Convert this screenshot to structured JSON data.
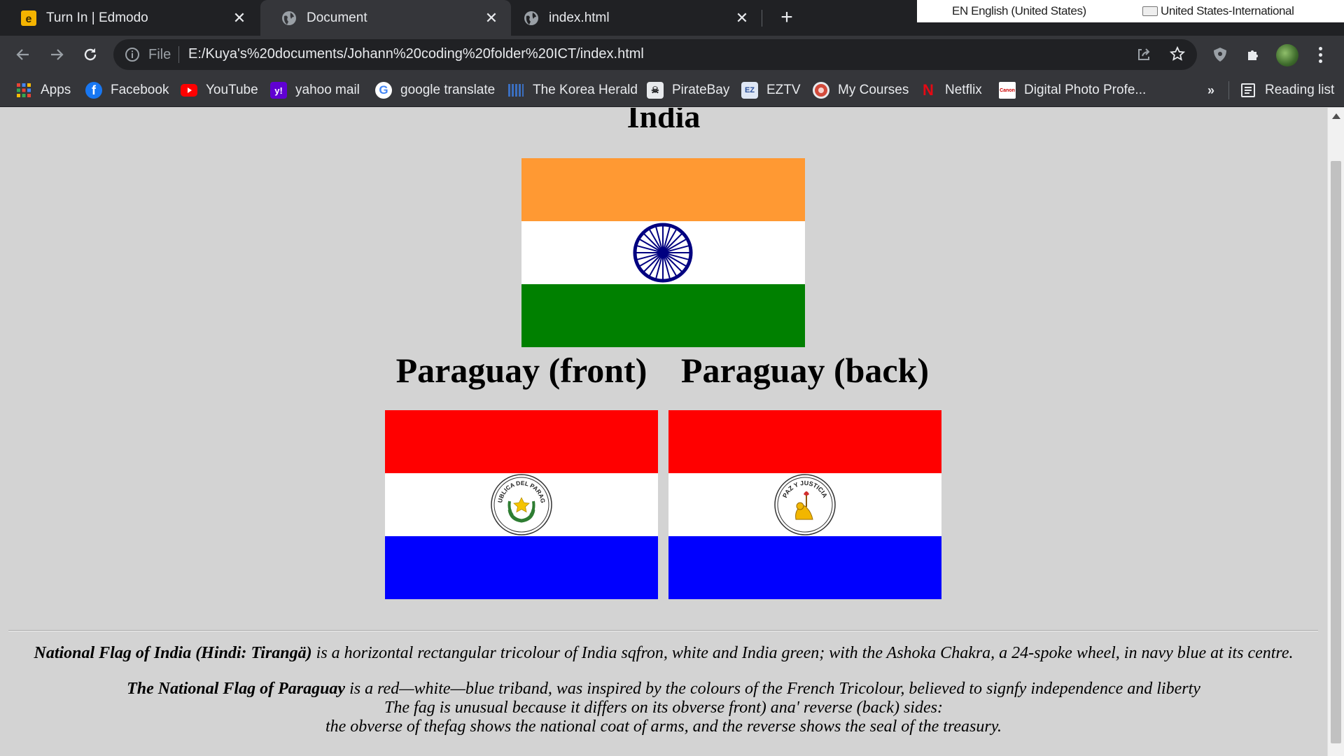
{
  "browser": {
    "tabs": [
      {
        "label": "Turn In | Edmodo",
        "favicon": "edmodo-icon"
      },
      {
        "label": "Document",
        "favicon": "globe-icon"
      },
      {
        "label": "index.html",
        "favicon": "globe-icon"
      }
    ],
    "new_tab": "+",
    "ime": {
      "language": "EN English (United States)",
      "keyboard": "United States-International"
    },
    "omnibox": {
      "scheme_label": "File",
      "url": "E:/Kuya's%20documents/Johann%20coding%20folder%20ICT/index.html"
    },
    "bookmarks": [
      {
        "label": "Apps",
        "icon": "apps-grid-icon"
      },
      {
        "label": "Facebook",
        "icon": "facebook-icon"
      },
      {
        "label": "YouTube",
        "icon": "youtube-icon"
      },
      {
        "label": "yahoo mail",
        "icon": "yahoo-icon"
      },
      {
        "label": "google translate",
        "icon": "google-icon"
      },
      {
        "label": "The Korea Herald",
        "icon": "korea-herald-icon"
      },
      {
        "label": "PirateBay",
        "icon": "piratebay-icon"
      },
      {
        "label": "EZTV",
        "icon": "eztv-icon"
      },
      {
        "label": "My Courses",
        "icon": "my-courses-icon"
      },
      {
        "label": "Netflix",
        "icon": "netflix-icon"
      },
      {
        "label": "Digital Photo Profe...",
        "icon": "canon-icon"
      }
    ],
    "bookmarks_overflow": "»",
    "reading_list": "Reading list"
  },
  "page": {
    "heading_india": "India",
    "heading_paraguay_front": "Paraguay (front)",
    "heading_paraguay_back": "Paraguay (back)",
    "india_flag_colors": {
      "saffron": "#ff9933",
      "white": "#ffffff",
      "green": "#008000",
      "chakra": "#000080"
    },
    "paraguay_flag_colors": {
      "red": "#ff0000",
      "white": "#ffffff",
      "blue": "#0000ff"
    },
    "paraguay_front_seal_text": "REPUBLICA DEL PARAGUAY",
    "paraguay_back_seal_text": "PAZ Y JUSTICIA",
    "india_desc_bold": "National Flag of India (Hindi: Tirangä)",
    "india_desc_rest": " is a horizontal rectangular tricolour of India sqfron, white and India green; with the Ashoka Chakra, a 24-spoke wheel, in navy blue at its centre.",
    "paraguay_desc_bold": "The National Flag of Paraguay",
    "paraguay_desc_rest": " is a red—white—blue triband, was inspired by the colours of the French Tricolour, believed to signfy independence and liberty",
    "paraguay_desc_line2": "The fag is unusual because it differs on its obverse front) ana' reverse (back) sides:",
    "paraguay_desc_line3": "the obverse of thefag shows the national coat of arms, and the reverse shows the seal of the treasury."
  }
}
